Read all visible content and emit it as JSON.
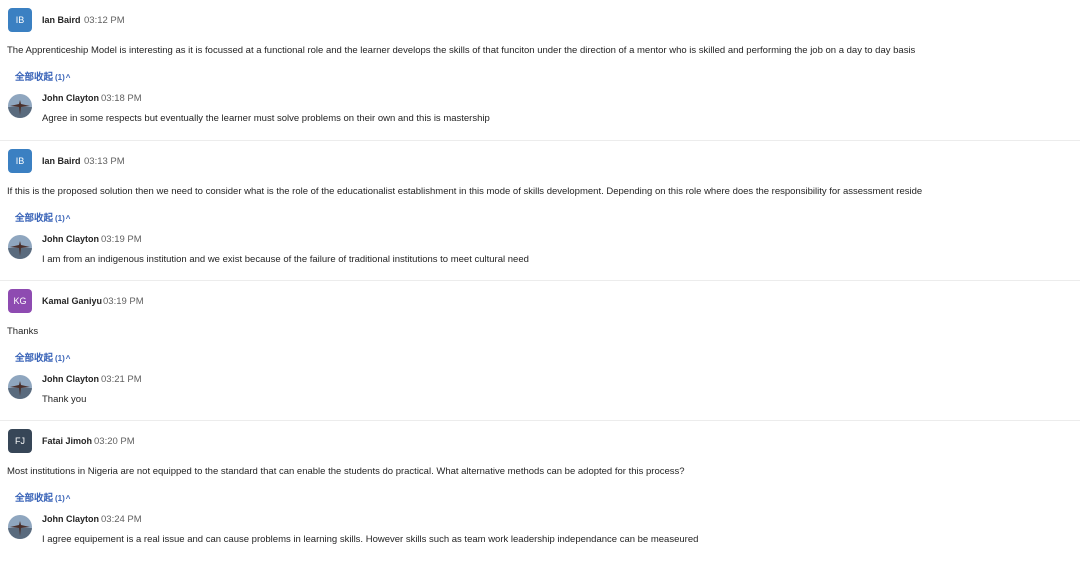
{
  "threads": [
    {
      "initials": "IB",
      "avatar_color": "#3b80c2",
      "author": "Ian Baird",
      "time": "03:12 PM",
      "message": "The Apprenticeship Model is interesting as it is focussed at a functional role and the learner develops the skills of that funciton under the direction of a mentor who is skilled and performing the job on a day to day basis",
      "collapse_label": "全部收起",
      "collapse_count": "(1)",
      "reply": {
        "author": "John Clayton",
        "time": "03:18 PM",
        "message": "Agree in some respects but eventually the learner must solve problems on their own and this is mastership"
      }
    },
    {
      "initials": "IB",
      "avatar_color": "#3b80c2",
      "author": "Ian Baird",
      "time": "03:13 PM",
      "message": "If this is the proposed solution then we need to consider what is the role of the educationalist establishment in this mode of skills development. Depending on this role where does the responsibility for assessment reside",
      "collapse_label": "全部收起",
      "collapse_count": "(1)",
      "reply": {
        "author": "John Clayton",
        "time": "03:19 PM",
        "message": "I am from an indigenous institution and we exist because of the failure of traditional institutions to meet cultural need"
      }
    },
    {
      "initials": "KG",
      "avatar_color": "#8e4bb1",
      "author": "Kamal Ganiyu",
      "time": "03:19 PM",
      "message": "Thanks",
      "collapse_label": "全部收起",
      "collapse_count": "(1)",
      "reply": {
        "author": "John Clayton",
        "time": "03:21 PM",
        "message": "Thank you"
      }
    },
    {
      "initials": "FJ",
      "avatar_color": "#374657",
      "author": "Fatai Jimoh",
      "time": "03:20 PM",
      "message": "Most institutions in Nigeria are not equipped to the standard that can enable the students do practical. What alternative methods can be adopted for this process?",
      "collapse_label": "全部收起",
      "collapse_count": "(1)",
      "reply": {
        "author": "John Clayton",
        "time": "03:24 PM",
        "message": "I agree equipement is a real issue and can cause problems in learning skills. However skills such as team work leadership independance can be measeured"
      }
    }
  ]
}
